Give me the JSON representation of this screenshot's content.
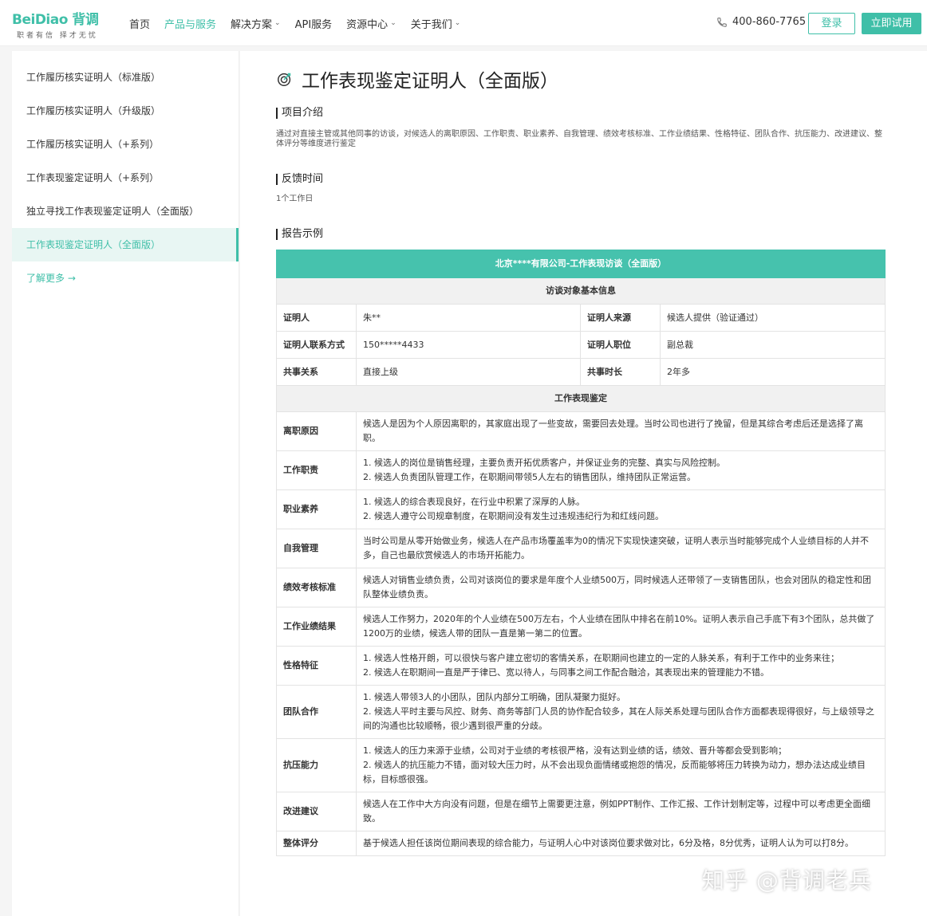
{
  "header": {
    "logo_text": "BeiDiao 背调",
    "logo_slogan": "职者有信  择才无忧",
    "nav": [
      {
        "label": "首页",
        "has_dropdown": false,
        "active": false
      },
      {
        "label": "产品与服务",
        "has_dropdown": false,
        "active": true
      },
      {
        "label": "解决方案",
        "has_dropdown": true,
        "active": false
      },
      {
        "label": "API服务",
        "has_dropdown": false,
        "active": false
      },
      {
        "label": "资源中心",
        "has_dropdown": true,
        "active": false
      },
      {
        "label": "关于我们",
        "has_dropdown": true,
        "active": false
      }
    ],
    "phone": "400-860-7765",
    "login_label": "登录",
    "try_label": "立即试用"
  },
  "sidebar": {
    "items": [
      {
        "label": "工作履历核实证明人（标准版）",
        "active": false
      },
      {
        "label": "工作履历核实证明人（升级版）",
        "active": false
      },
      {
        "label": "工作履历核实证明人（+系列）",
        "active": false
      },
      {
        "label": "工作表现鉴定证明人（+系列）",
        "active": false
      },
      {
        "label": "独立寻找工作表现鉴定证明人（全面版）",
        "active": false
      },
      {
        "label": "工作表现鉴定证明人（全面版）",
        "active": true
      }
    ],
    "more_label": "了解更多 →"
  },
  "main": {
    "title": "工作表现鉴定证明人（全面版）",
    "intro_heading": "项目介绍",
    "intro_text": "通过对直接主管或其他同事的访谈，对候选人的离职原因、工作职责、职业素养、自我管理、绩效考核标准、工作业绩结果、性格特征、团队合作、抗压能力、改进建议、整体评分等维度进行鉴定",
    "feedback_heading": "反馈时间",
    "feedback_text": "1个工作日",
    "report_heading": "报告示例"
  },
  "report": {
    "banner": "北京****有限公司-工作表现访谈（全面版）",
    "basic_heading": "访谈对象基本信息",
    "basic_rows": [
      {
        "k1": "证明人",
        "v1": "朱**",
        "k2": "证明人来源",
        "v2": "候选人提供（验证通过）"
      },
      {
        "k1": "证明人联系方式",
        "v1": "150*****4433",
        "k2": "证明人职位",
        "v2": "副总裁"
      },
      {
        "k1": "共事关系",
        "v1": "直接上级",
        "k2": "共事时长",
        "v2": "2年多"
      }
    ],
    "eval_heading": "工作表现鉴定",
    "eval_rows": [
      {
        "label": "离职原因",
        "lines": [
          "候选人是因为个人原因离职的，其家庭出现了一些变故，需要回去处理。当时公司也进行了挽留，但是其综合考虑后还是选择了离职。"
        ]
      },
      {
        "label": "工作职责",
        "lines": [
          "1. 候选人的岗位是销售经理，主要负责开拓优质客户，并保证业务的完整、真实与风险控制。",
          "2. 候选人负责团队管理工作，在职期间带领5人左右的销售团队，维持团队正常运营。"
        ]
      },
      {
        "label": "职业素养",
        "lines": [
          "1. 候选人的综合表现良好，在行业中积累了深厚的人脉。",
          "2. 候选人遵守公司规章制度，在职期间没有发生过违规违纪行为和红线问题。"
        ]
      },
      {
        "label": "自我管理",
        "lines": [
          "当时公司是从零开始做业务，候选人在产品市场覆盖率为0的情况下实现快速突破，证明人表示当时能够完成个人业绩目标的人并不多，自己也最欣赏候选人的市场开拓能力。"
        ]
      },
      {
        "label": "绩效考核标准",
        "lines": [
          "候选人对销售业绩负责，公司对该岗位的要求是年度个人业绩500万，同时候选人还带领了一支销售团队，也会对团队的稳定性和团队整体业绩负责。"
        ]
      },
      {
        "label": "工作业绩结果",
        "lines": [
          "候选人工作努力，2020年的个人业绩在500万左右，个人业绩在团队中排名在前10%。证明人表示自己手底下有3个团队，总共做了1200万的业绩，候选人带的团队一直是第一第二的位置。"
        ]
      },
      {
        "label": "性格特征",
        "lines": [
          "1. 候选人性格开朗，可以很快与客户建立密切的客情关系，在职期间也建立的一定的人脉关系，有利于工作中的业务来往；",
          "2. 候选人在职期间一直是严于律已、宽以待人，与同事之间工作配合融洽，其表现出来的管理能力不错。"
        ]
      },
      {
        "label": "团队合作",
        "lines": [
          "1. 候选人带领3人的小团队，团队内部分工明确，团队凝聚力挺好。",
          "2. 候选人平时主要与风控、财务、商务等部门人员的协作配合较多，其在人际关系处理与团队合作方面都表现得很好，与上级领导之间的沟通也比较顺畅，很少遇到很严重的分歧。"
        ]
      },
      {
        "label": "抗压能力",
        "lines": [
          "1. 候选人的压力来源于业绩，公司对于业绩的考核很严格，没有达到业绩的话，绩效、晋升等都会受到影响；",
          "2. 候选人的抗压能力不错，面对较大压力时，从不会出现负面情绪或抱怨的情况，反而能够将压力转换为动力，想办法达成业绩目标，目标感很强。"
        ]
      },
      {
        "label": "改进建议",
        "lines": [
          "候选人在工作中大方向没有问题，但是在细节上需要更注意，例如PPT制作、工作汇报、工作计划制定等，过程中可以考虑更全面细致。"
        ]
      },
      {
        "label": "整体评分",
        "lines": [
          "基于候选人担任该岗位期间表现的综合能力，与证明人心中对该岗位要求做对比，6分及格，8分优秀，证明人认为可以打8分。"
        ]
      }
    ]
  },
  "watermark": "知乎 @背调老兵",
  "colors": {
    "accent": "#3fbfa8",
    "banner": "#46c2ad"
  }
}
